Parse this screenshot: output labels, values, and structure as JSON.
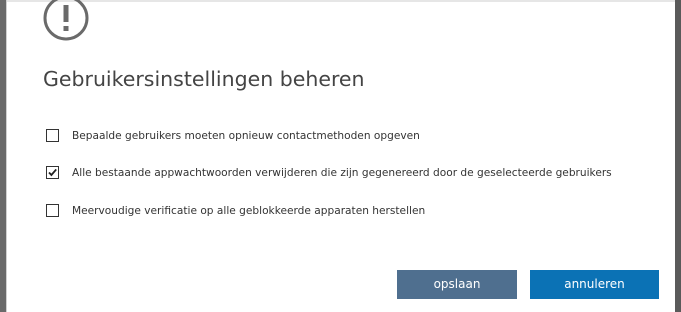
{
  "dialog": {
    "icon": "exclamation-circle-icon",
    "title": "Gebruikersinstellingen beheren",
    "options": [
      {
        "label": "Bepaalde gebruikers moeten opnieuw contactmethoden opgeven",
        "checked": false
      },
      {
        "label": "Alle bestaande appwachtwoorden verwijderen die zijn gegenereerd door de geselecteerde gebruikers",
        "checked": true
      },
      {
        "label": "Meervoudige verificatie op alle geblokkeerde apparaten herstellen",
        "checked": false
      }
    ],
    "save_label": "opslaan",
    "cancel_label": "annuleren"
  },
  "colors": {
    "save_button": "#4f6f8f",
    "cancel_button": "#0b72b5",
    "title_text": "#444444"
  }
}
